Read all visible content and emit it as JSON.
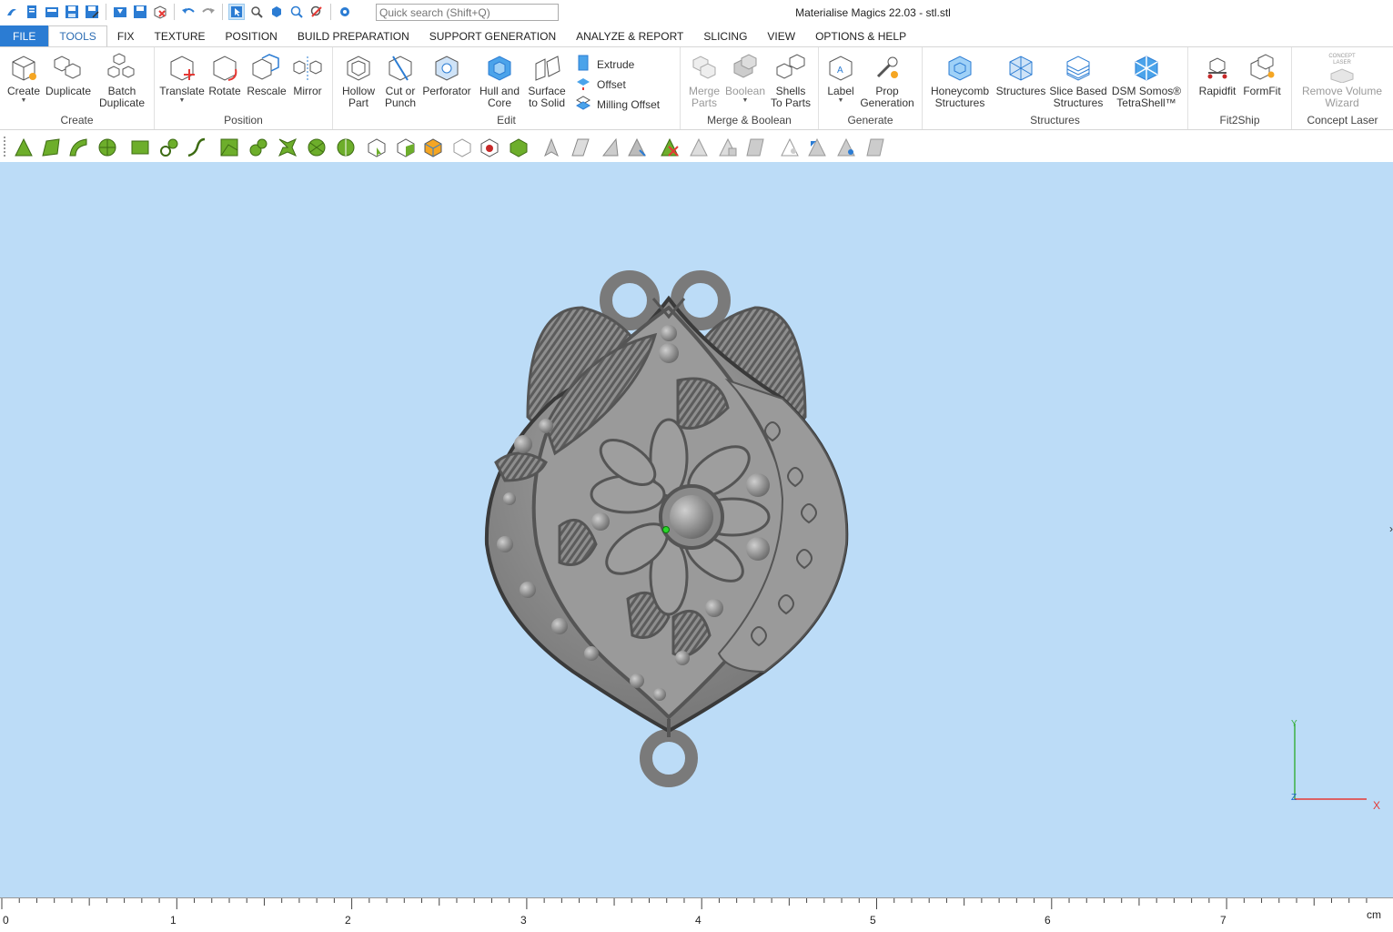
{
  "window": {
    "title": "Materialise Magics 22.03 - stl.stl"
  },
  "quick_access": {
    "search_placeholder": "Quick search (Shift+Q)",
    "icons": [
      "app-logo-icon",
      "new-scene-icon",
      "open-icon",
      "save-icon",
      "save-as-icon",
      "import-part-icon",
      "save-part-icon",
      "unload-part-icon",
      "undo-icon",
      "redo-icon",
      "select-icon",
      "zoom-window-icon",
      "select-part-icon",
      "zoom-icon",
      "clear-icon",
      "settings-icon"
    ]
  },
  "ribbon_tabs": [
    {
      "label": "FILE"
    },
    {
      "label": "TOOLS"
    },
    {
      "label": "FIX"
    },
    {
      "label": "TEXTURE"
    },
    {
      "label": "POSITION"
    },
    {
      "label": "BUILD PREPARATION"
    },
    {
      "label": "SUPPORT GENERATION"
    },
    {
      "label": "ANALYZE & REPORT"
    },
    {
      "label": "SLICING"
    },
    {
      "label": "VIEW"
    },
    {
      "label": "OPTIONS & HELP"
    }
  ],
  "active_tab": "TOOLS",
  "groups": {
    "create": {
      "label": "Create",
      "buttons": [
        "Create",
        "Duplicate",
        "Batch\nDuplicate"
      ]
    },
    "position": {
      "label": "Position",
      "buttons": [
        "Translate",
        "Rotate",
        "Rescale",
        "Mirror"
      ]
    },
    "edit": {
      "label": "Edit",
      "buttons": [
        "Hollow\nPart",
        "Cut or\nPunch",
        "Perforator",
        "Hull and\nCore",
        "Surface\nto Solid"
      ],
      "small_buttons": [
        "Extrude",
        "Offset",
        "Milling Offset"
      ]
    },
    "merge": {
      "label": "Merge & Boolean",
      "buttons": [
        "Merge\nParts",
        "Boolean",
        "Shells\nTo Parts"
      ]
    },
    "generate": {
      "label": "Generate",
      "buttons": [
        "Label",
        "Prop\nGeneration"
      ]
    },
    "structures": {
      "label": "Structures",
      "buttons": [
        "Honeycomb\nStructures",
        "Structures",
        "Slice Based\nStructures",
        "DSM Somos®\nTetraShell™"
      ]
    },
    "fit2ship": {
      "label": "Fit2Ship",
      "buttons": [
        "Rapidfit",
        "FormFit"
      ]
    },
    "concept": {
      "label": "Concept Laser",
      "buttons": [
        "Remove Volume\nWizard"
      ],
      "logo_text": "CONCEPT\nLASER"
    }
  },
  "colors": {
    "file_tab": "#2b7cd3",
    "viewport_bg": "#bcdcf7",
    "model_gray": "#8a8a8a",
    "axis_y": "#3cb043",
    "axis_x": "#e53935",
    "axis_z": "#1e60c8",
    "icon_green": "#6dae2b"
  },
  "viewport": {
    "axes": {
      "y": "Y",
      "x": "X",
      "z": "Z"
    }
  },
  "ruler": {
    "labels": [
      "0",
      "1",
      "2",
      "3",
      "4",
      "5",
      "6",
      "7"
    ],
    "unit": "cm"
  }
}
